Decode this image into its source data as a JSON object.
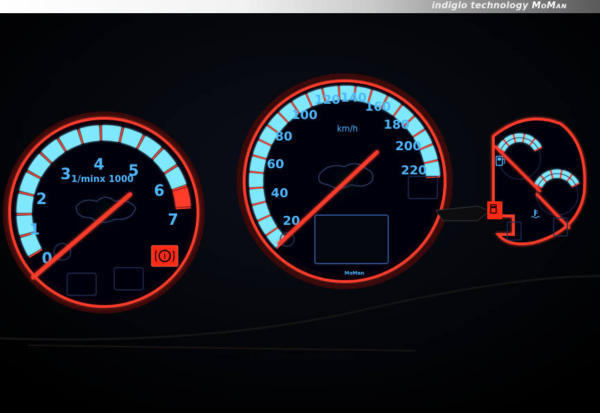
{
  "header": {
    "tagline": "indiglo technology",
    "brand": "MoMan"
  },
  "colors": {
    "accent_red": "#ff3b2a",
    "glow_cyan": "#7fe8ff",
    "numeral_blue": "#3fb3ff",
    "background": "#000000"
  },
  "tachometer": {
    "unit_label": "1/minx 1000",
    "tick_labels": [
      "0",
      "1",
      "2",
      "3",
      "4",
      "5",
      "6",
      "7"
    ],
    "redline_label": "6"
  },
  "speedometer": {
    "unit_label": "km/h",
    "tick_labels": [
      "20",
      "40",
      "60",
      "80",
      "100",
      "120",
      "140",
      "160",
      "180",
      "200",
      "220"
    ],
    "maker_label": "MoMan"
  },
  "aux_gauges": {
    "fuel_icon": "fuel-pump-icon",
    "temp_icon": "coolant-temperature-icon"
  },
  "warning_lamps": {
    "brake_icon": "brake-warning-icon",
    "fuel_lamp_icon": "fuel-warning-icon"
  }
}
